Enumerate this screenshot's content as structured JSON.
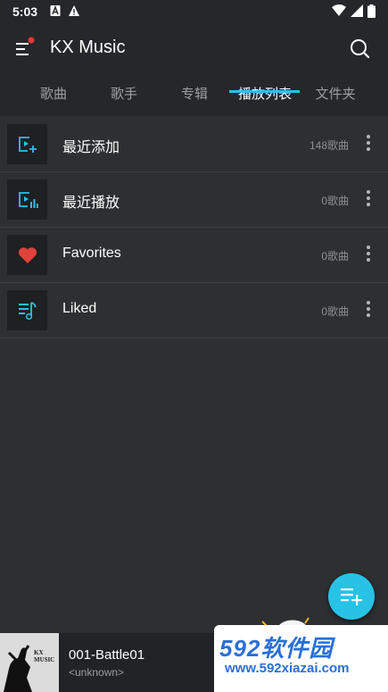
{
  "status_bar": {
    "time": "5:03"
  },
  "app": {
    "title": "KX Music"
  },
  "tabs": [
    {
      "label": "歌曲"
    },
    {
      "label": "歌手"
    },
    {
      "label": "专辑"
    },
    {
      "label": "播放列表",
      "active": true
    },
    {
      "label": "文件夹"
    }
  ],
  "playlists": [
    {
      "name": "最近添加",
      "count": "148歌曲",
      "icon": "recently-added-icon"
    },
    {
      "name": "最近播放",
      "count": "0歌曲",
      "icon": "recently-played-icon"
    },
    {
      "name": "Favorites",
      "count": "0歌曲",
      "icon": "heart-icon"
    },
    {
      "name": "Liked",
      "count": "0歌曲",
      "icon": "playlist-music-icon"
    }
  ],
  "now_playing": {
    "title": "001-Battle01",
    "artist": "<unknown>",
    "cover_text": "KX MUSIC"
  },
  "watermark": {
    "brand": "592软件园",
    "url": "www.592xiazai.com"
  },
  "colors": {
    "accent": "#28c2e6",
    "background": "#2e2f31",
    "appbar": "#26272a",
    "heart": "#e0413a"
  }
}
